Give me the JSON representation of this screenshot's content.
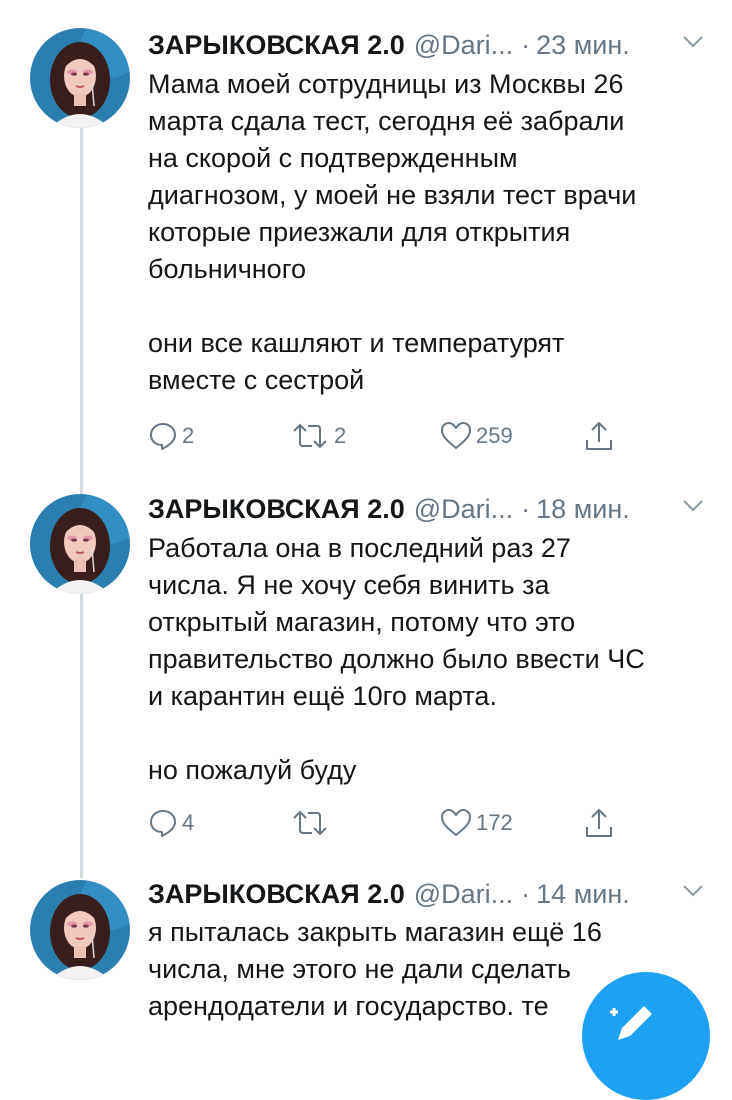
{
  "tweets": [
    {
      "name": "ЗАРЫКОВСКАЯ 2.0",
      "handle": "@Dari...",
      "separator": "·",
      "time": "23 мин.",
      "lines": [
        "Мама моей сотрудницы из Москвы 26",
        "марта сдала тест, сегодня её забрали",
        "на скорой с подтвержденным",
        "диагнозом, у моей не взяли тест врачи",
        "которые приезжали для открытия",
        "больничного"
      ],
      "lines2": [
        "они все кашляют и температурят",
        "вместе с сестрой"
      ],
      "replies": "2",
      "retweets": "2",
      "likes": "259"
    },
    {
      "name": "ЗАРЫКОВСКАЯ 2.0",
      "handle": "@Dari...",
      "separator": "·",
      "time": "18 мин.",
      "lines": [
        "Работала она в последний раз 27",
        "числа. Я не хочу себя винить за",
        "открытый магазин, потому что это",
        "правительство должно было ввести ЧС",
        "и карантин ещё 10го марта."
      ],
      "lines2": [
        "но пожалуй буду"
      ],
      "replies": "4",
      "retweets": "",
      "likes": "172"
    },
    {
      "name": "ЗАРЫКОВСКАЯ 2.0",
      "handle": "@Dari...",
      "separator": "·",
      "time": "14 мин.",
      "lines": [
        "я пыталась закрыть магазин ещё 16",
        "числа, мне этого не дали сделать",
        "арендодатели и государство. те"
      ],
      "lines2": []
    }
  ],
  "colors": {
    "accent": "#1da1f2",
    "secondary_text": "#657786",
    "primary_text": "#14171a"
  },
  "icons": [
    "reply-icon",
    "retweet-icon",
    "like-icon",
    "share-icon",
    "chevron-down-icon",
    "compose-icon"
  ]
}
